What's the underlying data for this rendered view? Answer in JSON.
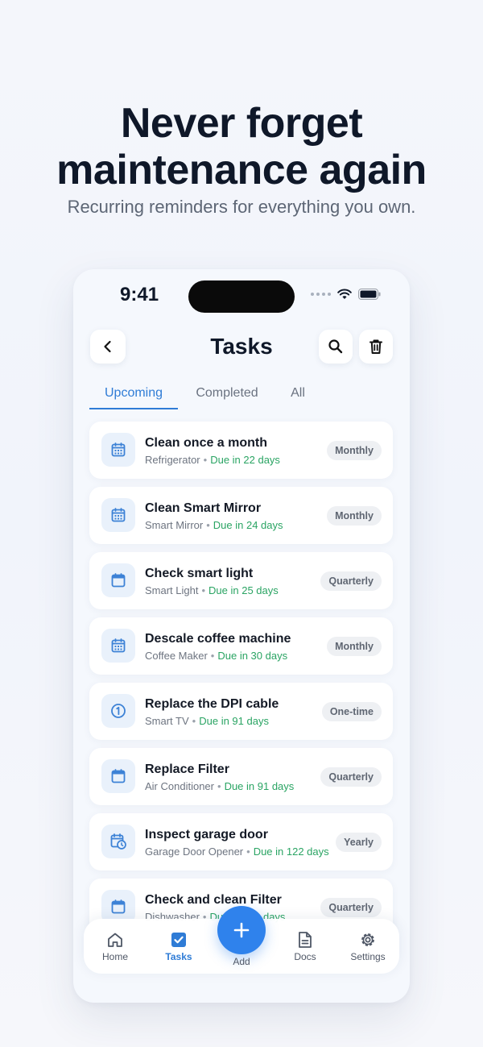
{
  "marketing": {
    "headline_line1": "Never forget",
    "headline_line2": "maintenance again",
    "subhead": "Recurring reminders for everything you own."
  },
  "status_bar": {
    "time": "9:41"
  },
  "header": {
    "title": "Tasks"
  },
  "tabs": [
    {
      "label": "Upcoming",
      "active": true
    },
    {
      "label": "Completed",
      "active": false
    },
    {
      "label": "All",
      "active": false
    }
  ],
  "tasks": [
    {
      "title": "Clean once a month",
      "item": "Refrigerator",
      "due": "Due in 22 days",
      "frequency": "Monthly",
      "icon": "calendar-icon"
    },
    {
      "title": "Clean Smart Mirror",
      "item": "Smart Mirror",
      "due": "Due in 24 days",
      "frequency": "Monthly",
      "icon": "calendar-icon"
    },
    {
      "title": "Check smart light",
      "item": "Smart Light",
      "due": "Due in 25 days",
      "frequency": "Quarterly",
      "icon": "calendar-icon"
    },
    {
      "title": "Descale coffee machine",
      "item": "Coffee Maker",
      "due": "Due in 30 days",
      "frequency": "Monthly",
      "icon": "calendar-icon"
    },
    {
      "title": "Replace the DPI cable",
      "item": "Smart TV",
      "due": "Due in 91 days",
      "frequency": "One-time",
      "icon": "one-time-icon"
    },
    {
      "title": "Replace Filter",
      "item": "Air Conditioner",
      "due": "Due in 91 days",
      "frequency": "Quarterly",
      "icon": "calendar-icon"
    },
    {
      "title": "Inspect garage door",
      "item": "Garage Door Opener",
      "due": "Due in 122 days",
      "frequency": "Yearly",
      "icon": "calendar-clock-icon"
    },
    {
      "title": "Check and clean Filter",
      "item": "Dishwasher",
      "due": "Due in 122 days",
      "frequency": "Quarterly",
      "icon": "calendar-icon"
    }
  ],
  "tabbar": {
    "home": "Home",
    "tasks": "Tasks",
    "add": "Add",
    "docs": "Docs",
    "settings": "Settings"
  },
  "colors": {
    "accent": "#2f7cd6",
    "due_green": "#2aa463",
    "fab": "#2f82ec"
  }
}
